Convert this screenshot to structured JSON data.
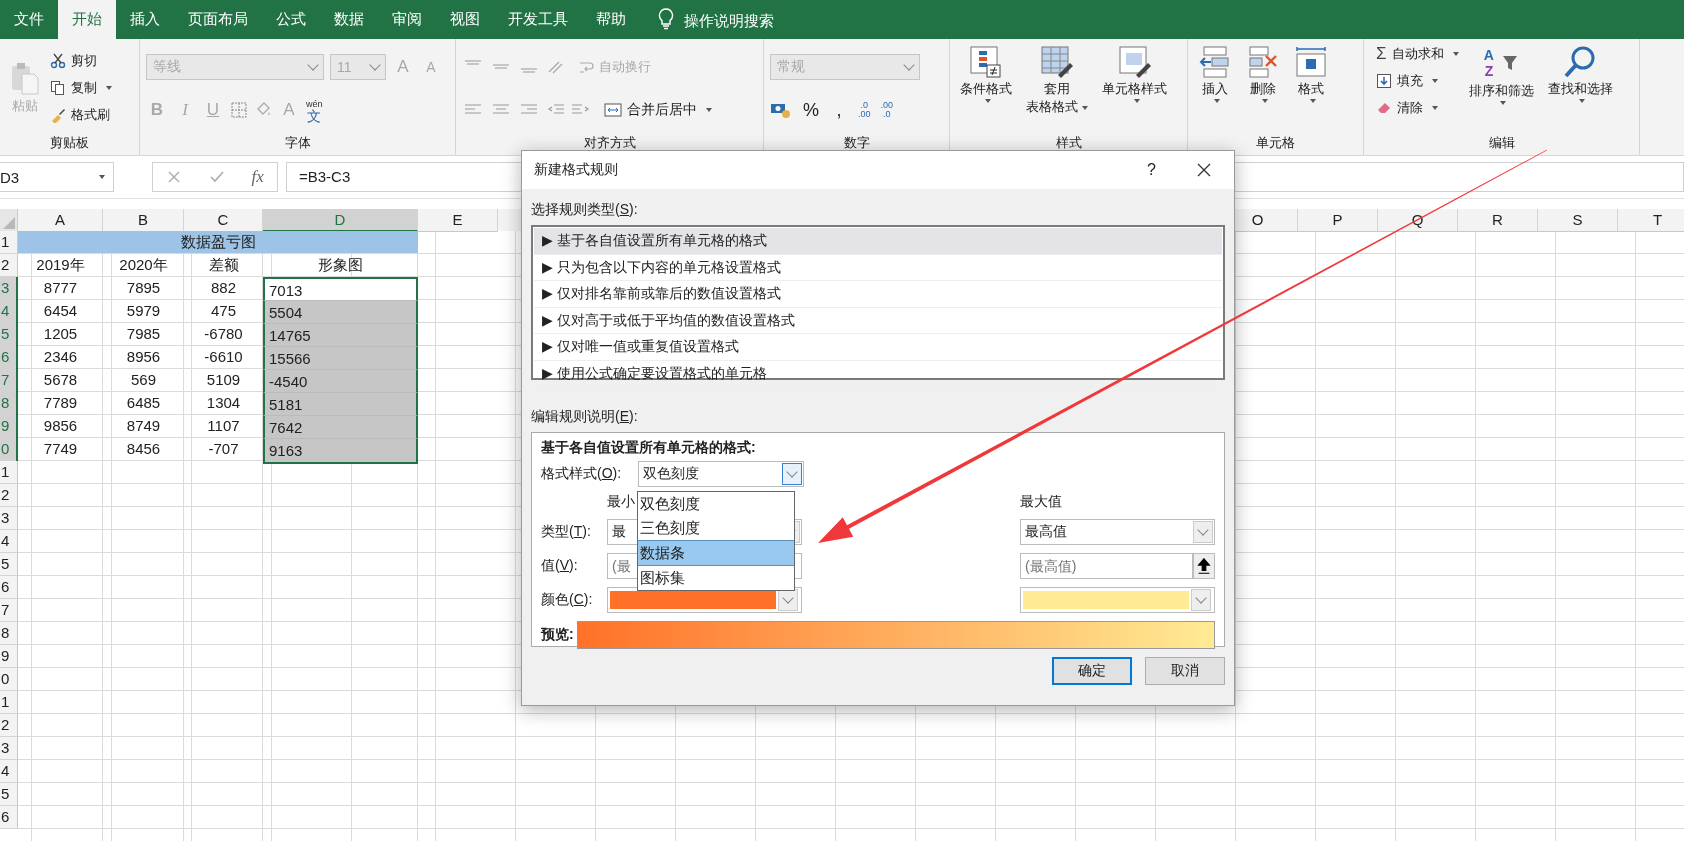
{
  "tabs": [
    {
      "label": "文件",
      "selected": false
    },
    {
      "label": "开始",
      "selected": true
    },
    {
      "label": "插入",
      "selected": false
    },
    {
      "label": "页面布局",
      "selected": false
    },
    {
      "label": "公式",
      "selected": false
    },
    {
      "label": "数据",
      "selected": false
    },
    {
      "label": "审阅",
      "selected": false
    },
    {
      "label": "视图",
      "selected": false
    },
    {
      "label": "开发工具",
      "selected": false
    },
    {
      "label": "帮助",
      "selected": false
    }
  ],
  "tell_me": "操作说明搜索",
  "clipboard": {
    "label": "剪贴板",
    "paste": "粘贴",
    "paste_disabled": true,
    "cut": "剪切",
    "copy": "复制",
    "format_painter": "格式刷"
  },
  "font": {
    "label": "字体",
    "disabled": true,
    "font_name": "等线",
    "font_size": "11",
    "grow": "A",
    "shrink": "A",
    "bold": "B",
    "italic": "I",
    "underline": "U",
    "font_color": "A",
    "phonetic_ruby": "wén",
    "phonetic": "文"
  },
  "alignment": {
    "label": "对齐方式",
    "wrap_text": "自动换行",
    "wrap_disabled": true,
    "merge_center": "合并后居中"
  },
  "number": {
    "label": "数字",
    "format": "常规",
    "format_disabled": true,
    "percent": "%",
    "comma": ",",
    "increase_decimal": [
      ".0",
      ".00"
    ],
    "decrease_decimal": [
      ".00",
      ".0"
    ]
  },
  "styles": {
    "label": "样式",
    "conditional": "条件格式",
    "table_format": [
      "套用",
      "表格格式"
    ],
    "cell_styles": "单元格样式"
  },
  "cells": {
    "label": "单元格",
    "insert": "插入",
    "delete": "删除",
    "format": "格式"
  },
  "editing": {
    "label": "编辑",
    "sigma": "Σ",
    "autosum": "自动求和",
    "fill": "填充",
    "clear": "清除",
    "sort_letters": [
      "A",
      "Z"
    ],
    "sort_filter": "排序和筛选",
    "find_select": "查找和选择"
  },
  "formula_bar": {
    "name_box": "D3",
    "fx": "fx",
    "formula": "=B3-C3"
  },
  "sheet": {
    "columns_left": [
      {
        "label": "A",
        "selected": false
      },
      {
        "label": "B",
        "selected": false
      },
      {
        "label": "C",
        "selected": false
      },
      {
        "label": "D",
        "selected": true
      },
      {
        "label": "E",
        "selected": false
      }
    ],
    "columns_right": [
      {
        "label": "O",
        "selected": false
      },
      {
        "label": "P",
        "selected": false
      },
      {
        "label": "Q",
        "selected": false
      },
      {
        "label": "R",
        "selected": false
      },
      {
        "label": "S",
        "selected": false
      },
      {
        "label": "T",
        "selected": false
      }
    ],
    "rows": [
      {
        "kind": "title",
        "header": "1",
        "title": "数据盈亏图"
      },
      {
        "kind": "header",
        "header": "2",
        "cells": [
          "2019年",
          "2020年",
          "差额",
          "形象图"
        ]
      },
      {
        "kind": "data",
        "header": "3",
        "cells": [
          "8777",
          "7895",
          "882",
          "7013"
        ],
        "selected": true,
        "active": true
      },
      {
        "kind": "data",
        "header": "4",
        "cells": [
          "6454",
          "5979",
          "475",
          "5504"
        ],
        "selected": true,
        "active": false
      },
      {
        "kind": "data",
        "header": "5",
        "cells": [
          "1205",
          "7985",
          "-6780",
          "14765"
        ],
        "selected": true,
        "active": false
      },
      {
        "kind": "data",
        "header": "6",
        "cells": [
          "2346",
          "8956",
          "-6610",
          "15566"
        ],
        "selected": true,
        "active": false
      },
      {
        "kind": "data",
        "header": "7",
        "cells": [
          "5678",
          "569",
          "5109",
          "-4540"
        ],
        "selected": true,
        "active": false
      },
      {
        "kind": "data",
        "header": "8",
        "cells": [
          "7789",
          "6485",
          "1304",
          "5181"
        ],
        "selected": true,
        "active": false
      },
      {
        "kind": "data",
        "header": "9",
        "cells": [
          "9856",
          "8749",
          "1107",
          "7642"
        ],
        "selected": true,
        "active": false
      },
      {
        "kind": "data",
        "header": "0",
        "cells": [
          "7749",
          "8456",
          "-707",
          "9163"
        ],
        "selected": true,
        "active": false
      },
      {
        "kind": "empty",
        "header": "1"
      },
      {
        "kind": "empty",
        "header": "2"
      },
      {
        "kind": "empty",
        "header": "3"
      },
      {
        "kind": "empty",
        "header": "4"
      },
      {
        "kind": "empty",
        "header": "5"
      },
      {
        "kind": "empty",
        "header": "6"
      },
      {
        "kind": "empty",
        "header": "7"
      },
      {
        "kind": "empty",
        "header": "8"
      },
      {
        "kind": "empty",
        "header": "9"
      },
      {
        "kind": "empty",
        "header": "0"
      },
      {
        "kind": "empty",
        "header": "1"
      },
      {
        "kind": "empty",
        "header": "2"
      },
      {
        "kind": "empty",
        "header": "3"
      },
      {
        "kind": "empty",
        "header": "4"
      },
      {
        "kind": "empty",
        "header": "5"
      },
      {
        "kind": "empty",
        "header": "6"
      }
    ]
  },
  "dialog": {
    "title": "新建格式规则",
    "help": "?",
    "rule_type_label": {
      "pre": "选择规则类型(",
      "key": "S",
      "post": "):"
    },
    "rule_types": [
      {
        "label": "▶ 基于各自值设置所有单元格的格式",
        "selected": true
      },
      {
        "label": "▶ 只为包含以下内容的单元格设置格式",
        "selected": false
      },
      {
        "label": "▶ 仅对排名靠前或靠后的数值设置格式",
        "selected": false
      },
      {
        "label": "▶ 仅对高于或低于平均值的数值设置格式",
        "selected": false
      },
      {
        "label": "▶ 仅对唯一值或重复值设置格式",
        "selected": false
      },
      {
        "label": "▶ 使用公式确定要设置格式的单元格",
        "selected": false
      }
    ],
    "edit_label": {
      "pre": "编辑规则说明(",
      "key": "E",
      "post": "):"
    },
    "description": "基于各自值设置所有单元格的格式:",
    "style_label": {
      "pre": "格式样式(",
      "key": "O",
      "post": "):"
    },
    "style_value": "双色刻度",
    "style_options": [
      {
        "label": "双色刻度",
        "selected": false
      },
      {
        "label": "三色刻度",
        "selected": false
      },
      {
        "label": "数据条",
        "selected": true
      },
      {
        "label": "图标集",
        "selected": false
      }
    ],
    "min_heading": "最小",
    "max_heading": "最大值",
    "type_label": {
      "pre": "类型(",
      "key": "T",
      "post": "):"
    },
    "min_type": "最",
    "max_type": "最高值",
    "value_label": {
      "pre": "值(",
      "key": "V",
      "post": "):"
    },
    "min_value_placeholder": "(最",
    "max_value_placeholder": "(最高值)",
    "color_label": {
      "pre": "颜色(",
      "key": "C",
      "post": "):"
    },
    "preview_label": "预览:",
    "ok": "确定",
    "cancel": "取消"
  }
}
